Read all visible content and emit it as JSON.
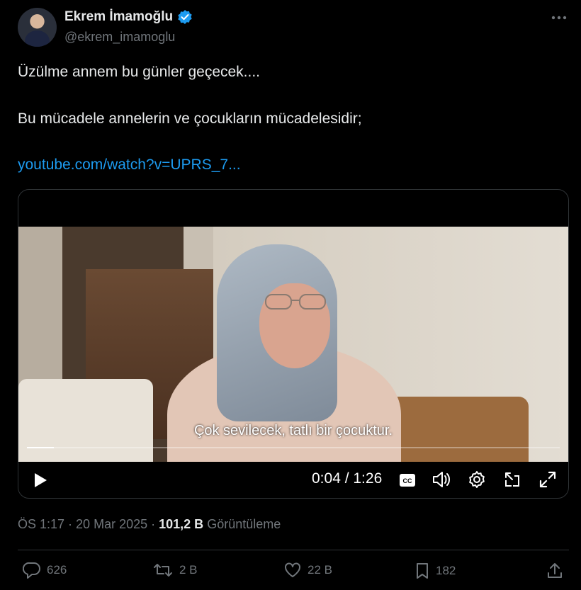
{
  "author": {
    "name": "Ekrem İmamoğlu",
    "handle": "@ekrem_imamoglu",
    "verified_color": "#1d9bf0"
  },
  "tweet": {
    "line1": "Üzülme annem bu günler geçecek....",
    "line2": "Bu mücadele annelerin ve çocukların mücadelesidir;",
    "link": "youtube.com/watch?v=UPRS_7..."
  },
  "video": {
    "subtitle": "Çok sevilecek, tatlı bir çocuktur.",
    "time": "0:04 / 1:26",
    "progress_fraction": 0.05,
    "cc_label": "CC"
  },
  "meta": {
    "time": "ÖS 1:17",
    "date": "20 Mar 2025",
    "views_count": "101,2 B",
    "views_label": "Görüntüleme"
  },
  "actions": {
    "replies": "626",
    "reposts": "2 B",
    "likes": "22 B",
    "bookmarks": "182"
  },
  "colors": {
    "accent": "#1d9bf0",
    "muted": "#71767b",
    "text": "#e7e9ea"
  }
}
